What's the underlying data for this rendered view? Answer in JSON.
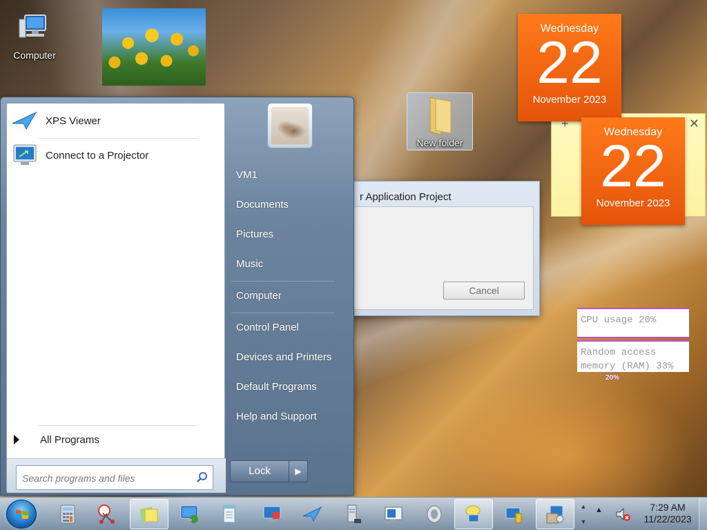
{
  "desktop": {
    "icons": [
      {
        "label": "Computer",
        "icon": "computer-icon"
      },
      {
        "label": "New folder",
        "icon": "folder-icon"
      }
    ]
  },
  "gadgets": {
    "calendar_top": {
      "weekday": "Wednesday",
      "day": "22",
      "month_year": "November 2023"
    },
    "calendar_front": {
      "weekday": "Wednesday",
      "day": "22",
      "month_year": "November 2023"
    },
    "sticky_note": {
      "add": "+",
      "close": "✕"
    },
    "meter": {
      "cpu": "CPU usage 20%",
      "ram": "Random access memory (RAM) 33%",
      "percent": "20%"
    }
  },
  "dialog": {
    "title": "r Application Project",
    "cancel_label": "Cancel"
  },
  "start_menu": {
    "programs": [
      {
        "label": "XPS Viewer",
        "icon": "xps-viewer-icon"
      },
      {
        "label": "Connect to a Projector",
        "icon": "projector-icon"
      }
    ],
    "all_programs": "All Programs",
    "search_placeholder": "Search programs and files",
    "right_items": [
      "VM1",
      "Documents",
      "Pictures",
      "Music",
      "Computer",
      "Control Panel",
      "Devices and Printers",
      "Default Programs",
      "Help and Support"
    ],
    "lock_label": "Lock",
    "lock_arrow": "▶"
  },
  "taskbar": {
    "clock_time": "7:29 AM",
    "clock_date": "11/22/2023",
    "tray_arrow": "▲",
    "pinned": [
      "calculator-icon",
      "snipping-tool-icon",
      "sticky-notes-icon",
      "remote-desktop-icon",
      "notepad-icon",
      "network-monitor-icon",
      "xps-viewer-icon",
      "server-icon",
      "display-icon",
      "speaker-icon",
      "chat-icon",
      "network-icon",
      "installer-icon"
    ]
  },
  "colors": {
    "calendar": "#e4540a",
    "start_menu": "#6d849e",
    "meter_border": "#c050c0"
  }
}
